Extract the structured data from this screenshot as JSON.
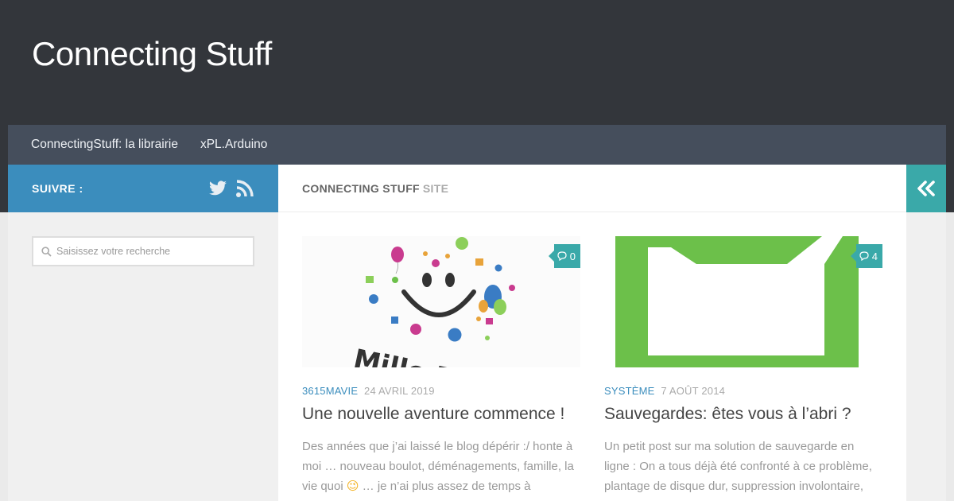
{
  "header": {
    "site_title": "Connecting Stuff"
  },
  "nav": {
    "items": [
      {
        "label": "ConnectingStuff: la librairie"
      },
      {
        "label": "xPL.Arduino"
      }
    ]
  },
  "sidebar": {
    "follow_label": "SUIVRE :",
    "social": [
      {
        "icon": "twitter-icon"
      },
      {
        "icon": "rss-icon"
      }
    ],
    "search": {
      "placeholder": "Saisissez votre recherche",
      "value": ""
    }
  },
  "main": {
    "page_title": {
      "main": "CONNECTING STUFF",
      "sub": "SITE"
    },
    "posts": [
      {
        "category": "3615MAVIE",
        "date": "24 AVRIL 2019",
        "title": "Une nouvelle aventure commence !",
        "excerpt_before_emoji": "Des années que j’ai laissé le blog dépérir :/ honte à moi … nouveau boulot, déménagements, famille, la vie quoi ",
        "emoji": "😉",
        "excerpt_after_emoji": " … je n’ai plus assez de temps à",
        "comments": "0",
        "thumbnail_text": "Mille Party"
      },
      {
        "category": "SYSTÈME",
        "date": "7 AOÛT 2014",
        "title": "Sauvegardes: êtes vous à l’abri ?",
        "excerpt": "Un petit post sur ma solution de sauvegarde en ligne : On a tous déjà été confronté à ce problème, plantage de disque dur, suppression involontaire, etc",
        "comments": "4"
      }
    ]
  },
  "colors": {
    "header_bg": "#33363b",
    "nav_bg": "#454e5c",
    "accent_blue": "#3b8dbd",
    "accent_teal": "#3aa9a9",
    "folder_green": "#6cc04a"
  }
}
